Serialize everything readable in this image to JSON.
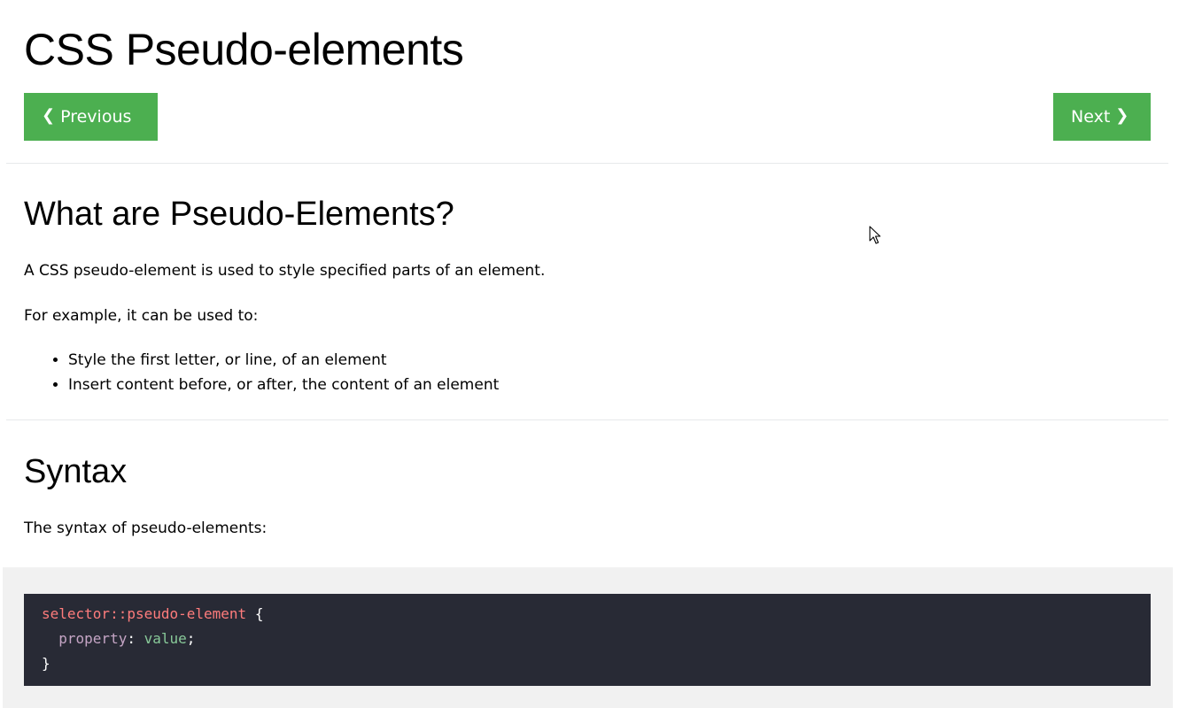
{
  "header": {
    "title": "CSS Pseudo-elements"
  },
  "nav": {
    "previous_label": "Previous",
    "next_label": "Next",
    "previous_icon": "chevron-left-icon",
    "next_icon": "chevron-right-icon",
    "button_color": "#4caf50"
  },
  "section_intro": {
    "heading": "What are Pseudo-Elements?",
    "paragraph_1": "A CSS pseudo-element is used to style specified parts of an element.",
    "paragraph_2": "For example, it can be used to:",
    "bullets": [
      "Style the first letter, or line, of an element",
      "Insert content before, or after, the content of an element"
    ]
  },
  "section_syntax": {
    "heading": "Syntax",
    "paragraph": "The syntax of pseudo-elements:",
    "code": {
      "selector": "selector::pseudo-element",
      "open_brace": " {",
      "property": "property",
      "colon": ": ",
      "value": "value",
      "semicolon": ";",
      "close_brace": "}"
    },
    "colors": {
      "code_background": "#282a35",
      "example_background": "#f1f1f1",
      "selector": "#ff7c7c",
      "property": "#c5a5c5",
      "value": "#88c999"
    }
  },
  "pointer": {
    "icon": "mouse-cursor-icon"
  }
}
